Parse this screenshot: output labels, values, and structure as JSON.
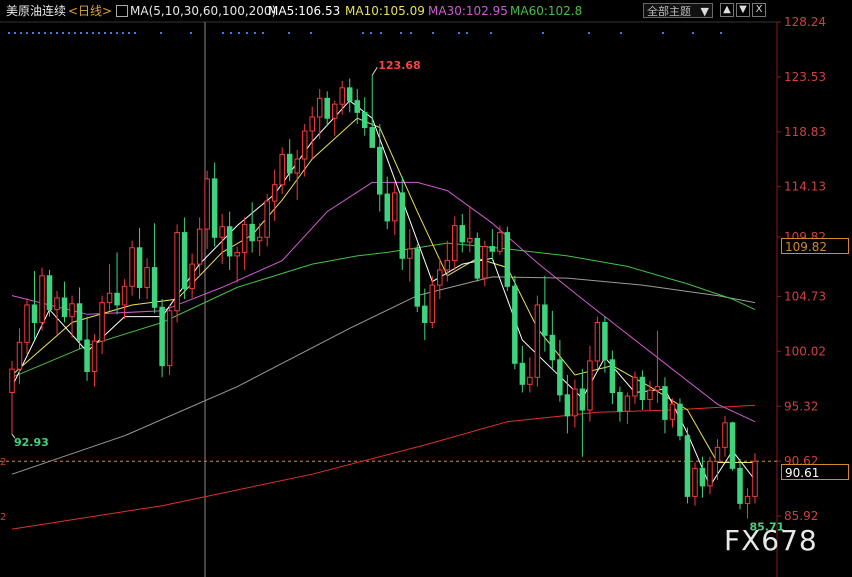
{
  "header": {
    "symbol": "美原油连续",
    "period": "<日线>",
    "ma_params": "MA(5,10,30,60,100,200)",
    "ma5": "MA5:106.53",
    "ma10": "MA10:105.09",
    "ma30": "MA30:102.95",
    "ma60": "MA60:102.8",
    "theme_label": "全部主题",
    "btn_up": "▲",
    "btn_down": "▼",
    "btn_close": "X"
  },
  "colors": {
    "up": "#f23a3a",
    "down": "#3ed47e",
    "ma5": "#ffffff",
    "ma10": "#e8e05a",
    "ma30": "#d05bd0",
    "ma60": "#46c046",
    "ma100": "#9a9a9a",
    "ma200": "#e03030",
    "axis_text": "#d04040",
    "current_line": "#e08a2a"
  },
  "chart_data": {
    "type": "candlestick",
    "y_axis_ticks": [
      "128.24",
      "123.53",
      "118.83",
      "114.13",
      "109.82",
      "104.73",
      "100.02",
      "95.32",
      "90.62",
      "85.92"
    ],
    "ylim": [
      84.5,
      128.24
    ],
    "current_price": "90.61",
    "current_box_top": "109.82",
    "high_label": "123.68",
    "high_value": 123.68,
    "low_label_left": "92.93",
    "low_value_left": 92.93,
    "low_label_right": "85.71",
    "low_value_right": 85.71,
    "candles_ohlc": [
      [
        96.5,
        99.2,
        92.9,
        98.5
      ],
      [
        98.5,
        102.0,
        97.2,
        100.8
      ],
      [
        100.8,
        104.6,
        99.8,
        104.0
      ],
      [
        104.0,
        106.9,
        101.0,
        102.5
      ],
      [
        102.5,
        107.2,
        101.8,
        106.5
      ],
      [
        106.5,
        107.0,
        103.0,
        103.6
      ],
      [
        103.6,
        105.2,
        101.5,
        104.6
      ],
      [
        104.6,
        106.0,
        102.5,
        103.0
      ],
      [
        103.0,
        104.8,
        101.2,
        104.1
      ],
      [
        104.1,
        105.5,
        100.2,
        101.0
      ],
      [
        101.0,
        103.0,
        97.5,
        98.3
      ],
      [
        98.3,
        101.5,
        97.0,
        100.9
      ],
      [
        100.9,
        104.8,
        99.8,
        104.2
      ],
      [
        104.2,
        107.5,
        103.5,
        105.0
      ],
      [
        105.0,
        108.5,
        103.2,
        104.0
      ],
      [
        104.0,
        106.2,
        102.8,
        105.6
      ],
      [
        105.6,
        109.5,
        104.8,
        108.9
      ],
      [
        108.9,
        110.6,
        104.5,
        105.5
      ],
      [
        105.5,
        108.0,
        104.5,
        107.2
      ],
      [
        107.2,
        111.0,
        103.3,
        103.8
      ],
      [
        103.8,
        104.5,
        97.8,
        98.8
      ],
      [
        98.8,
        104.0,
        98.0,
        103.5
      ],
      [
        103.5,
        110.9,
        102.5,
        110.2
      ],
      [
        110.2,
        111.5,
        104.5,
        105.4
      ],
      [
        105.4,
        108.4,
        104.6,
        107.5
      ],
      [
        107.5,
        111.5,
        106.5,
        110.5
      ],
      [
        110.5,
        115.5,
        108.8,
        114.8
      ],
      [
        114.8,
        116.2,
        109.0,
        109.8
      ],
      [
        109.8,
        111.8,
        107.5,
        110.7
      ],
      [
        110.7,
        112.0,
        107.0,
        108.2
      ],
      [
        108.2,
        109.0,
        105.9,
        108.5
      ],
      [
        108.5,
        111.5,
        107.0,
        110.9
      ],
      [
        110.9,
        112.8,
        108.5,
        109.5
      ],
      [
        109.5,
        111.0,
        108.2,
        109.8
      ],
      [
        109.8,
        113.5,
        109.0,
        112.9
      ],
      [
        112.9,
        115.6,
        111.2,
        114.3
      ],
      [
        114.3,
        117.5,
        113.5,
        116.9
      ],
      [
        116.9,
        118.2,
        114.6,
        115.3
      ],
      [
        115.3,
        117.3,
        113.0,
        116.5
      ],
      [
        116.5,
        119.5,
        115.0,
        118.9
      ],
      [
        118.9,
        121.0,
        116.5,
        120.1
      ],
      [
        120.1,
        122.5,
        118.2,
        121.7
      ],
      [
        121.7,
        122.3,
        119.3,
        120.0
      ],
      [
        120.0,
        121.5,
        118.5,
        121.2
      ],
      [
        121.2,
        123.2,
        120.3,
        122.6
      ],
      [
        122.6,
        123.4,
        120.5,
        121.5
      ],
      [
        121.5,
        122.5,
        119.5,
        120.5
      ],
      [
        120.5,
        121.8,
        118.5,
        119.2
      ],
      [
        119.2,
        123.68,
        117.5,
        117.5
      ],
      [
        117.5,
        119.5,
        112.0,
        113.5
      ],
      [
        113.5,
        115.0,
        110.5,
        111.2
      ],
      [
        111.2,
        114.5,
        110.0,
        113.6
      ],
      [
        113.6,
        115.0,
        107.0,
        108.0
      ],
      [
        108.0,
        110.5,
        106.0,
        108.8
      ],
      [
        108.8,
        109.2,
        103.4,
        103.9
      ],
      [
        103.9,
        105.4,
        101.0,
        102.5
      ],
      [
        102.5,
        106.5,
        102.0,
        105.7
      ],
      [
        105.7,
        108.0,
        104.5,
        107.0
      ],
      [
        107.0,
        109.5,
        106.0,
        107.8
      ],
      [
        107.8,
        111.6,
        107.0,
        110.8
      ],
      [
        110.8,
        111.8,
        108.5,
        109.4
      ],
      [
        109.4,
        112.5,
        108.5,
        109.7
      ],
      [
        109.7,
        110.2,
        106.0,
        106.3
      ],
      [
        106.3,
        109.5,
        105.6,
        109.0
      ],
      [
        109.0,
        110.5,
        107.8,
        108.6
      ],
      [
        108.6,
        110.8,
        108.3,
        110.2
      ],
      [
        110.2,
        110.7,
        105.2,
        105.6
      ],
      [
        105.6,
        106.5,
        98.5,
        99.0
      ],
      [
        99.0,
        100.5,
        96.5,
        97.2
      ],
      [
        97.2,
        99.5,
        96.5,
        97.8
      ],
      [
        97.8,
        104.8,
        97.0,
        104.0
      ],
      [
        104.0,
        106.5,
        100.0,
        101.4
      ],
      [
        101.4,
        103.5,
        98.5,
        99.3
      ],
      [
        99.3,
        101.0,
        95.7,
        96.3
      ],
      [
        96.3,
        98.0,
        93.0,
        94.5
      ],
      [
        94.5,
        97.6,
        93.5,
        96.8
      ],
      [
        96.8,
        98.5,
        91.0,
        95.0
      ],
      [
        95.0,
        100.5,
        94.0,
        99.2
      ],
      [
        99.2,
        103.0,
        98.5,
        102.5
      ],
      [
        102.5,
        103.0,
        98.2,
        99.3
      ],
      [
        99.3,
        100.1,
        95.5,
        96.5
      ],
      [
        96.5,
        97.0,
        94.0,
        94.9
      ],
      [
        94.9,
        96.5,
        93.8,
        96.2
      ],
      [
        96.2,
        98.3,
        95.5,
        97.8
      ],
      [
        97.8,
        98.4,
        95.0,
        95.9
      ],
      [
        95.9,
        97.5,
        95.0,
        96.7
      ],
      [
        96.7,
        101.8,
        95.6,
        97.0
      ],
      [
        97.0,
        97.8,
        93.0,
        94.2
      ],
      [
        94.2,
        96.0,
        93.5,
        95.5
      ],
      [
        95.5,
        96.0,
        92.4,
        92.8
      ],
      [
        92.8,
        93.5,
        87.0,
        87.6
      ],
      [
        87.6,
        90.5,
        86.8,
        90.0
      ],
      [
        90.0,
        91.0,
        87.5,
        88.5
      ],
      [
        88.5,
        91.0,
        87.8,
        90.6
      ],
      [
        90.6,
        92.5,
        89.0,
        91.8
      ],
      [
        91.8,
        94.5,
        91.0,
        93.9
      ],
      [
        93.9,
        94.0,
        89.8,
        90.0
      ],
      [
        90.0,
        90.8,
        86.5,
        87.0
      ],
      [
        87.0,
        88.3,
        85.71,
        87.6
      ],
      [
        87.6,
        91.3,
        87.0,
        90.61
      ]
    ],
    "ma_series": [
      {
        "name": "MA5",
        "values": [
          [
            0,
            97.0
          ],
          [
            5,
            103.6
          ],
          [
            10,
            100.0
          ],
          [
            15,
            103.0
          ],
          [
            20,
            103.0
          ],
          [
            25,
            107.5
          ],
          [
            30,
            110.8
          ],
          [
            35,
            113.5
          ],
          [
            40,
            118.0
          ],
          [
            45,
            121.5
          ],
          [
            48,
            120.0
          ],
          [
            52,
            113.0
          ],
          [
            56,
            106.0
          ],
          [
            60,
            107.5
          ],
          [
            64,
            108.0
          ],
          [
            68,
            101.0
          ],
          [
            72,
            98.5
          ],
          [
            76,
            96.0
          ],
          [
            79,
            99.5
          ],
          [
            83,
            96.5
          ],
          [
            87,
            96.8
          ],
          [
            90,
            93.0
          ],
          [
            93,
            88.5
          ],
          [
            96,
            91.5
          ],
          [
            99,
            89.0
          ]
        ]
      },
      {
        "name": "MA10",
        "values": [
          [
            0,
            98.0
          ],
          [
            8,
            102.5
          ],
          [
            16,
            104.0
          ],
          [
            22,
            104.5
          ],
          [
            28,
            108.5
          ],
          [
            32,
            110.0
          ],
          [
            36,
            113.0
          ],
          [
            40,
            116.5
          ],
          [
            46,
            120.0
          ],
          [
            49,
            119.2
          ],
          [
            54,
            112.0
          ],
          [
            58,
            106.5
          ],
          [
            62,
            108.0
          ],
          [
            66,
            107.2
          ],
          [
            70,
            102.0
          ],
          [
            75,
            98.0
          ],
          [
            80,
            98.8
          ],
          [
            85,
            97.0
          ],
          [
            90,
            95.0
          ],
          [
            94,
            90.5
          ],
          [
            99,
            90.5
          ]
        ]
      },
      {
        "name": "MA30",
        "values": [
          [
            0,
            104.8
          ],
          [
            10,
            103.2
          ],
          [
            20,
            103.5
          ],
          [
            28,
            105.5
          ],
          [
            36,
            107.8
          ],
          [
            42,
            112.0
          ],
          [
            48,
            114.5
          ],
          [
            54,
            114.5
          ],
          [
            58,
            113.8
          ],
          [
            64,
            111.0
          ],
          [
            70,
            107.6
          ],
          [
            76,
            104.5
          ],
          [
            82,
            101.5
          ],
          [
            88,
            98.5
          ],
          [
            94,
            95.5
          ],
          [
            99,
            94.0
          ]
        ]
      },
      {
        "name": "MA60",
        "values": [
          [
            0,
            97.8
          ],
          [
            10,
            100.5
          ],
          [
            20,
            102.5
          ],
          [
            30,
            105.5
          ],
          [
            40,
            107.5
          ],
          [
            46,
            108.2
          ],
          [
            50,
            108.5
          ],
          [
            58,
            109.3
          ],
          [
            66,
            108.8
          ],
          [
            74,
            108.2
          ],
          [
            82,
            107.3
          ],
          [
            90,
            105.8
          ],
          [
            96,
            104.5
          ],
          [
            99,
            103.6
          ]
        ]
      },
      {
        "name": "MA100",
        "values": [
          [
            0,
            89.5
          ],
          [
            15,
            92.8
          ],
          [
            30,
            97.0
          ],
          [
            45,
            102.0
          ],
          [
            54,
            104.8
          ],
          [
            64,
            106.4
          ],
          [
            74,
            106.3
          ],
          [
            84,
            105.7
          ],
          [
            94,
            104.8
          ],
          [
            99,
            104.2
          ]
        ]
      },
      {
        "name": "MA200",
        "values": [
          [
            0,
            84.8
          ],
          [
            20,
            86.8
          ],
          [
            40,
            89.5
          ],
          [
            55,
            92.0
          ],
          [
            66,
            94.0
          ],
          [
            78,
            94.8
          ],
          [
            88,
            95.0
          ],
          [
            99,
            95.4
          ]
        ]
      }
    ]
  },
  "watermark": "FX678"
}
